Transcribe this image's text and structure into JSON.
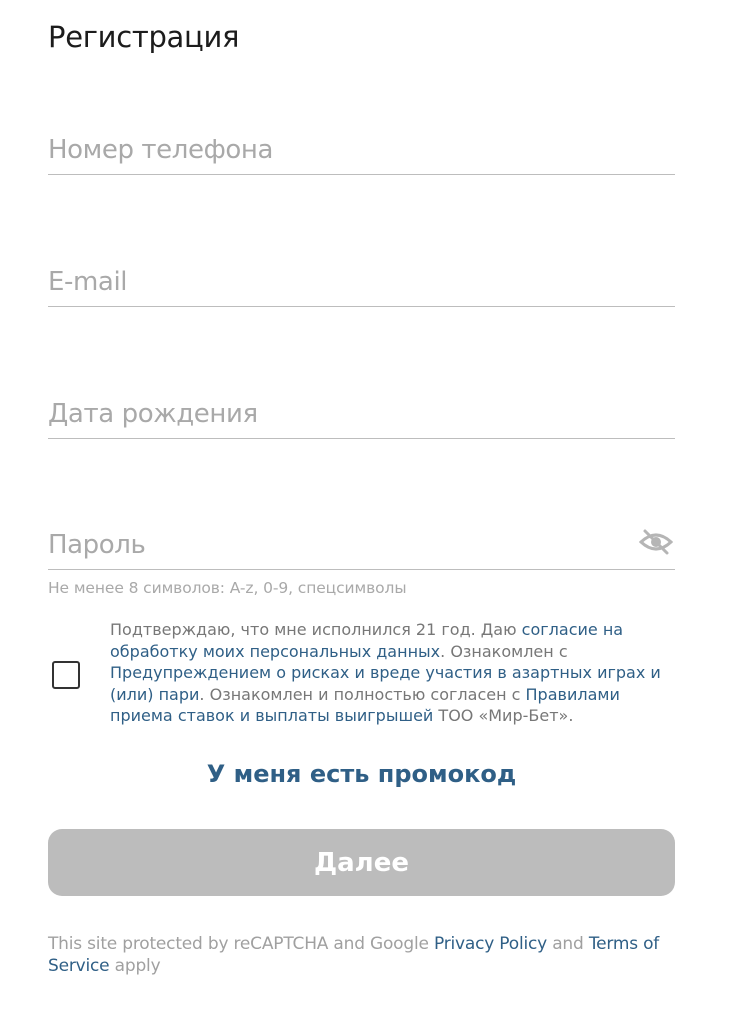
{
  "form": {
    "title": "Регистрация",
    "phone_placeholder": "Номер телефона",
    "email_placeholder": "E-mail",
    "birthdate_placeholder": "Дата рождения",
    "password_placeholder": "Пароль",
    "password_hint": "Не менее 8 символов: A-z, 0-9, спецсимволы",
    "password_toggle_icon": "eye-slash-icon"
  },
  "consent": {
    "checked": false,
    "text_1": "Подтверждаю, что мне исполнился 21 год. Даю ",
    "link_1": "согласие на обработку моих персональных данных",
    "text_2": ". Ознакомлен с ",
    "link_2": "Предупреждением о рисках и вреде участия в азартных играх и (или) пари",
    "text_3": ". Ознакомлен и полностью согласен с ",
    "link_3": "Правилами приема ставок и выплаты выигрышей",
    "text_4": " ТОО «Мир-Бет»."
  },
  "promo": {
    "label": "У меня есть промокод"
  },
  "next_button": {
    "label": "Далее"
  },
  "recaptcha": {
    "text_1": "This site protected by reCAPTCHA and Google ",
    "privacy_link": "Privacy Policy",
    "text_2": " and ",
    "terms_link": "Terms of Service",
    "text_3": " apply"
  },
  "colors": {
    "link": "#2f5f86",
    "placeholder": "#a9a9a9",
    "button_disabled": "#bcbcbc"
  }
}
